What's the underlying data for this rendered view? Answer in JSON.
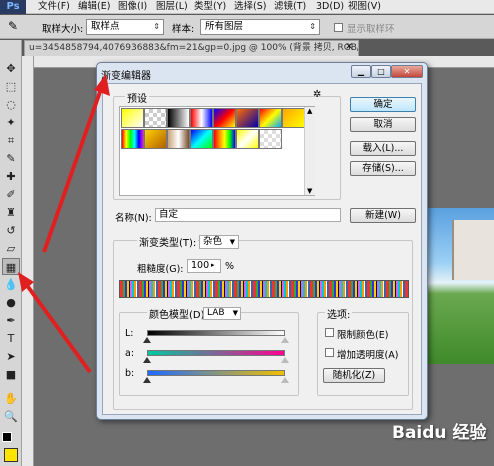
{
  "menubar": {
    "logo": "Ps",
    "items": [
      "文件(F)",
      "编辑(E)",
      "图像(I)",
      "图层(L)",
      "类型(Y)",
      "选择(S)",
      "滤镜(T)",
      "3D(D)",
      "视图(V)"
    ]
  },
  "options": {
    "sample_size_label": "取样大小:",
    "sample_size_value": "取样点",
    "sample_label": "样本:",
    "sample_value": "所有图层",
    "show_ring": "显示取样环"
  },
  "doc_tab": {
    "title": "u=3454858794,4076936883&fm=21&gp=0.jpg @ 100% (背景 拷贝, RGB/8#) *",
    "close": "×"
  },
  "dialog": {
    "title": "渐变编辑器",
    "presets_label": "预设",
    "buttons": {
      "ok": "确定",
      "cancel": "取消",
      "load": "载入(L)...",
      "save": "存储(S)...",
      "new": "新建(W)",
      "randomize": "随机化(Z)"
    },
    "name_label": "名称(N):",
    "name_value": "自定",
    "gradient_type_label": "渐变类型(T):",
    "gradient_type_value": "杂色",
    "roughness_label": "粗糙度(G):",
    "roughness_value": "100",
    "roughness_unit": "%",
    "color_model_label": "颜色模型(D)",
    "color_model_value": "LAB",
    "channels": [
      "L:",
      "a:",
      "b:"
    ],
    "options_label": "选项:",
    "restrict_colors": "限制颜色(E)",
    "add_transparency": "增加透明度(A)"
  },
  "watermark": "Baidu 经验"
}
